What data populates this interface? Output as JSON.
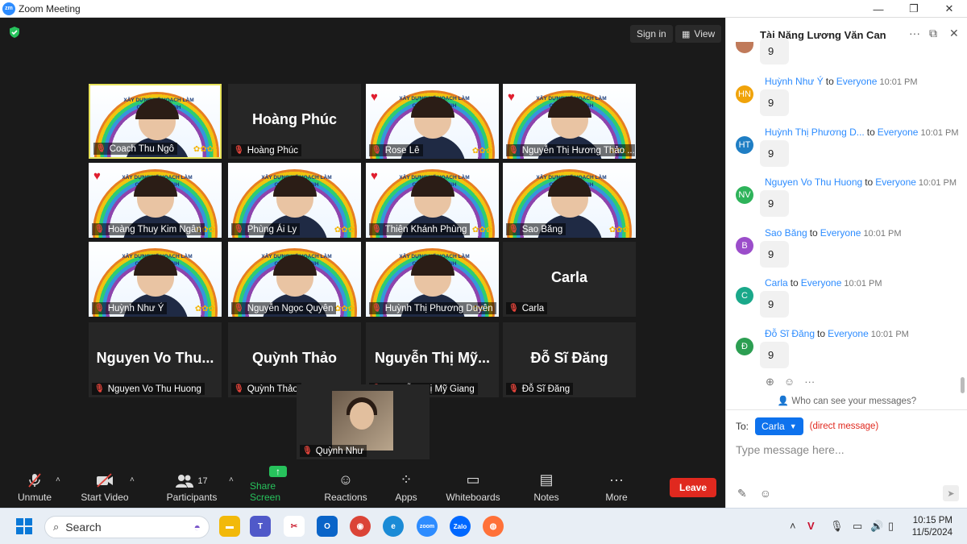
{
  "window": {
    "title": "Zoom Meeting",
    "logo_text": "zm",
    "minimize": "—",
    "maximize": "❐",
    "close": "✕"
  },
  "topbar": {
    "signin": "Sign in",
    "view": "View"
  },
  "tiles": [
    {
      "name": "Coach Thu Ngô",
      "active": true,
      "banner": "XÂY DỰNG KẾ HOẠCH LÀM CHỦ CHÍNH MÌNH"
    },
    {
      "name": "Hoàng Phúc",
      "big": "Hoàng Phúc"
    },
    {
      "name": "Rose Lê",
      "banner": "XÂY DỰNG KẾ HOẠCH LÀM CHỦ CHÍNH MÌNH"
    },
    {
      "name": "Nguyễn Thị Hương Thảo ...",
      "banner": "XÂY DỰNG KẾ HOẠCH LÀM CHỦ CHÍNH MÌNH"
    },
    {
      "name": "Hoàng Thuy Kim Ngân",
      "banner": "XÂY DỰNG KẾ HOẠCH LÀM CHỦ CHÍNH MÌNH"
    },
    {
      "name": "Phùng Ái Ly",
      "banner": "XÂY DỰNG KẾ HOẠCH LÀM CHỦ CHÍNH MÌNH"
    },
    {
      "name": "Thiên Khánh Phùng",
      "banner": "XÂY DỰNG KẾ HOẠCH LÀM CHỦ CHÍNH MÌNH"
    },
    {
      "name": "Sao Băng",
      "banner": "XÂY DỰNG KẾ HOẠCH LÀM CHỦ CHÍNH MÌNH"
    },
    {
      "name": "Huỳnh Như Ý",
      "banner": "XÂY DỰNG KẾ HOẠCH LÀM CHỦ CHÍNH MÌNH"
    },
    {
      "name": "Nguyễn Ngọc Quyên",
      "banner": "XÂY DỰNG KẾ HOẠCH LÀM CHỦ CHÍNH MÌNH"
    },
    {
      "name": "Huỳnh Thị Phương Duyên",
      "banner": "XÂY DỰNG KẾ HOẠCH LÀM CHỦ CHÍNH MÌNH"
    },
    {
      "name": "Carla",
      "big": "Carla"
    },
    {
      "name": "Nguyen Vo Thu Huong",
      "big": "Nguyen Vo Thu..."
    },
    {
      "name": "Quỳnh Thảo",
      "big": "Quỳnh Thảo"
    },
    {
      "name": "Nguyễn Thị Mỹ Giang",
      "big": "Nguyễn Thị Mỹ..."
    },
    {
      "name": "Đỗ Sĩ Đăng",
      "big": "Đỗ Sĩ Đăng"
    }
  ],
  "solo_tile": {
    "name": "Quỳnh Như"
  },
  "toolbar": {
    "unmute": "Unmute",
    "start_video": "Start Video",
    "participants": "Participants",
    "participants_count": "17",
    "share_screen": "Share Screen",
    "reactions": "Reactions",
    "apps": "Apps",
    "whiteboards": "Whiteboards",
    "notes": "Notes",
    "more": "More",
    "leave": "Leave"
  },
  "chat": {
    "header_name": "Tài Năng Lương Văn Can",
    "first_partial": "9",
    "messages": [
      {
        "initials": "HN",
        "color": "#f0a30a",
        "sender": "Huỳnh Như Ý",
        "to": "to",
        "target": "Everyone",
        "time": "10:01 PM",
        "text": "9"
      },
      {
        "initials": "HT",
        "color": "#1f7ec4",
        "sender": "Huỳnh Thị Phương D...",
        "to": "to",
        "target": "Everyone",
        "time": "10:01 PM",
        "text": "9"
      },
      {
        "initials": "NV",
        "color": "#2eb35a",
        "sender": "Nguyen Vo Thu Huong",
        "to": "to",
        "target": "Everyone",
        "time": "10:01 PM",
        "text": "9"
      },
      {
        "initials": "B",
        "color": "#9b4dca",
        "sender": "Sao Băng",
        "to": "to",
        "target": "Everyone",
        "time": "10:01 PM",
        "text": "9"
      },
      {
        "initials": "C",
        "color": "#1aa88a",
        "sender": "Carla",
        "to": "to",
        "target": "Everyone",
        "time": "10:01 PM",
        "text": "9"
      },
      {
        "initials": "Đ",
        "color": "#2c9e52",
        "sender": "Đỗ Sĩ Đăng",
        "to": "to",
        "target": "Everyone",
        "time": "10:01 PM",
        "text": "9"
      }
    ],
    "who_can_see": "Who can see your messages?",
    "to_label": "To:",
    "recipient": "Carla",
    "direct_message": "(direct message)",
    "placeholder": "Type message here..."
  },
  "taskbar": {
    "search": "Search",
    "time": "10:15 PM",
    "date": "11/5/2024"
  }
}
